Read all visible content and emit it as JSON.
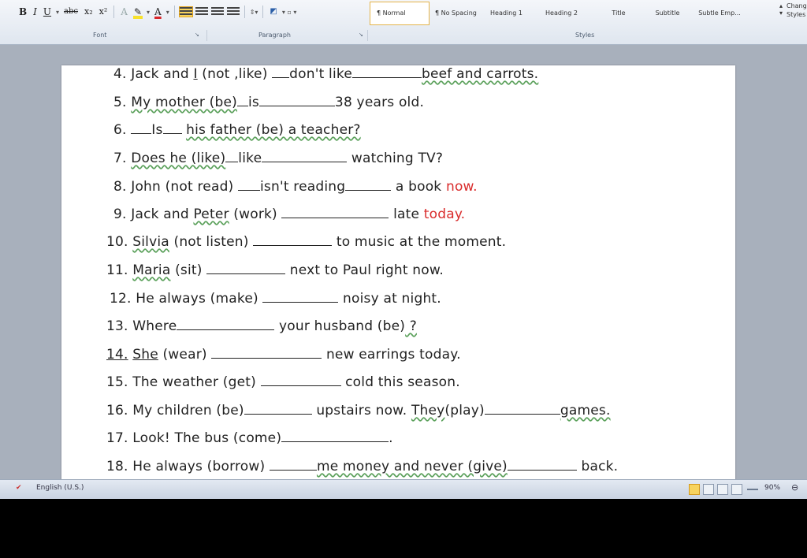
{
  "ribbon": {
    "format_buttons": [
      "B",
      "I",
      "U",
      "abc",
      "x₂",
      "x²"
    ],
    "font_group_label": "Font",
    "paragraph_group_label": "Paragraph",
    "styles_group_label": "Styles",
    "styles": [
      "¶ Normal",
      "¶ No Spacing",
      "Heading 1",
      "Heading 2",
      "Title",
      "Subtitle",
      "Subtle Emp..."
    ],
    "change_styles_label": "Change Styles"
  },
  "colors": {
    "highlight": "#f7e12b",
    "font_color": "#d9262a",
    "accent_red": "#d92b2b"
  },
  "exercise": [
    {
      "n": "4.",
      "parts": [
        "Jack and ",
        "I",
        " (not ,like) ",
        "don't like",
        "beef and carrots."
      ]
    },
    {
      "n": "5.",
      "parts": [
        "My mother (be)",
        "is",
        "38 years old."
      ]
    },
    {
      "n": "6.",
      "parts": [
        "Is",
        "his father (be)  a teacher?"
      ]
    },
    {
      "n": "7.",
      "parts": [
        "Does he (like)",
        "like",
        "watching TV?"
      ]
    },
    {
      "n": "8.",
      "parts": [
        "John (not read) ",
        "isn't reading",
        "a book ",
        "now."
      ]
    },
    {
      "n": "9.",
      "parts": [
        "Jack and ",
        "Peter",
        " (work) ",
        "late ",
        "today."
      ]
    },
    {
      "n": "10.",
      "parts": [
        "Silvia",
        " (not listen) ",
        "to music at the moment."
      ]
    },
    {
      "n": "11.",
      "parts": [
        "Maria",
        " (sit) ",
        "next to Paul right now."
      ]
    },
    {
      "n": "12.",
      "parts": [
        "He always (make) ",
        "noisy at night."
      ]
    },
    {
      "n": "13.",
      "parts": [
        "Where",
        "your husband (be)",
        " ?"
      ]
    },
    {
      "n": "14.",
      "parts": [
        "She",
        " (wear) ",
        "new earrings today."
      ]
    },
    {
      "n": "15.",
      "parts": [
        "The weather (get) ",
        "cold this season."
      ]
    },
    {
      "n": "16.",
      "parts": [
        "My children (be)",
        "upstairs now. ",
        "They",
        "(play)",
        "games."
      ]
    },
    {
      "n": "17.",
      "parts": [
        "Look! The bus (come)",
        "."
      ]
    },
    {
      "n": "18.",
      "parts": [
        "He always (borrow) ",
        "me money and never (give)",
        "back."
      ]
    }
  ],
  "statusbar": {
    "language": "English (U.S.)",
    "zoom": "90%"
  }
}
